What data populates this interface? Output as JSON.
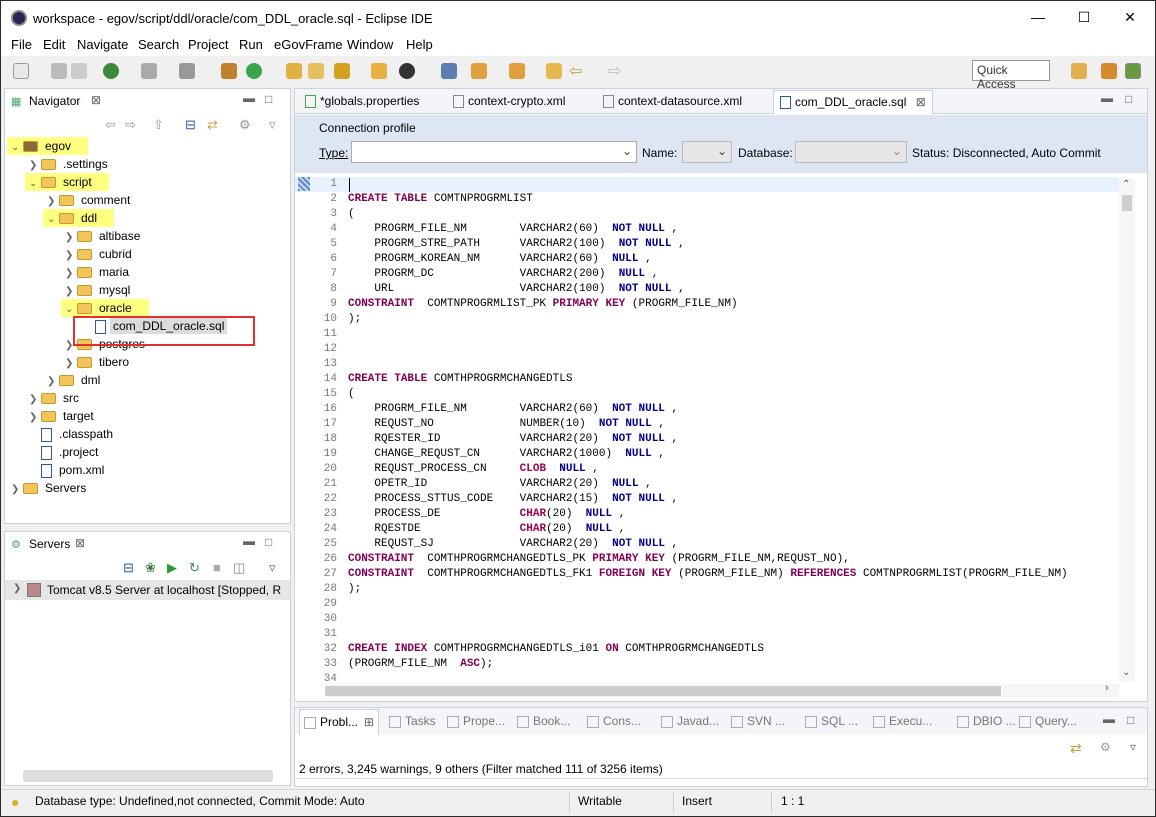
{
  "window": {
    "title": "workspace - egov/script/ddl/oracle/com_DDL_oracle.sql - Eclipse IDE"
  },
  "menu": [
    "File",
    "Edit",
    "Navigate",
    "Search",
    "Project",
    "Run",
    "eGovFrame",
    "Window",
    "Help"
  ],
  "toolbar": {
    "quick_access": "Quick Access"
  },
  "navigator": {
    "title": "Navigator",
    "tree": [
      {
        "label": "egov",
        "depth": 0,
        "type": "project",
        "expanded": true,
        "highlight": true
      },
      {
        "label": ".settings",
        "depth": 1,
        "type": "folder",
        "expanded": false
      },
      {
        "label": "script",
        "depth": 1,
        "type": "folder",
        "expanded": true,
        "highlight": true
      },
      {
        "label": "comment",
        "depth": 2,
        "type": "folder",
        "expanded": false
      },
      {
        "label": "ddl",
        "depth": 2,
        "type": "folder",
        "expanded": true,
        "highlight": true
      },
      {
        "label": "altibase",
        "depth": 3,
        "type": "folder",
        "expanded": false
      },
      {
        "label": "cubrid",
        "depth": 3,
        "type": "folder",
        "expanded": false
      },
      {
        "label": "maria",
        "depth": 3,
        "type": "folder",
        "expanded": false
      },
      {
        "label": "mysql",
        "depth": 3,
        "type": "folder",
        "expanded": false
      },
      {
        "label": "oracle",
        "depth": 3,
        "type": "folder",
        "expanded": true,
        "highlight": true
      },
      {
        "label": "com_DDL_oracle.sql",
        "depth": 4,
        "type": "file",
        "selected": true
      },
      {
        "label": "postgres",
        "depth": 3,
        "type": "folder",
        "expanded": false
      },
      {
        "label": "tibero",
        "depth": 3,
        "type": "folder",
        "expanded": false
      },
      {
        "label": "dml",
        "depth": 2,
        "type": "folder",
        "expanded": false
      },
      {
        "label": "src",
        "depth": 1,
        "type": "folder",
        "expanded": false
      },
      {
        "label": "target",
        "depth": 1,
        "type": "folder",
        "expanded": false
      },
      {
        "label": ".classpath",
        "depth": 1,
        "type": "xfile"
      },
      {
        "label": ".project",
        "depth": 1,
        "type": "xfile"
      },
      {
        "label": "pom.xml",
        "depth": 1,
        "type": "mfile"
      },
      {
        "label": "Servers",
        "depth": 0,
        "type": "folder",
        "expanded": false
      }
    ]
  },
  "servers": {
    "title": "Servers",
    "item": "Tomcat v8.5 Server at localhost  [Stopped, R"
  },
  "editor_tabs": [
    {
      "label": "*globals.properties",
      "active": false
    },
    {
      "label": "context-crypto.xml",
      "active": false
    },
    {
      "label": "context-datasource.xml",
      "active": false
    },
    {
      "label": "com_DDL_oracle.sql",
      "active": true
    }
  ],
  "connection": {
    "title": "Connection profile",
    "type_label": "Type:",
    "name_label": "Name:",
    "database_label": "Database:",
    "status": "Status: Disconnected, Auto Commit"
  },
  "code_lines": [
    "",
    "CREATE TABLE COMTNPROGRMLIST",
    "(",
    "    PROGRM_FILE_NM        VARCHAR2(60)  NOT NULL ,",
    "    PROGRM_STRE_PATH      VARCHAR2(100)  NOT NULL ,",
    "    PROGRM_KOREAN_NM      VARCHAR2(60)  NULL ,",
    "    PROGRM_DC             VARCHAR2(200)  NULL ,",
    "    URL                   VARCHAR2(100)  NOT NULL ,",
    "CONSTRAINT  COMTNPROGRMLIST_PK PRIMARY KEY (PROGRM_FILE_NM)",
    ");",
    "",
    "",
    "",
    "CREATE TABLE COMTHPROGRMCHANGEDTLS",
    "(",
    "    PROGRM_FILE_NM        VARCHAR2(60)  NOT NULL ,",
    "    REQUST_NO             NUMBER(10)  NOT NULL ,",
    "    RQESTER_ID            VARCHAR2(20)  NOT NULL ,",
    "    CHANGE_REQUST_CN      VARCHAR2(1000)  NULL ,",
    "    REQUST_PROCESS_CN     CLOB  NULL ,",
    "    OPETR_ID              VARCHAR2(20)  NULL ,",
    "    PROCESS_STTUS_CODE    VARCHAR2(15)  NOT NULL ,",
    "    PROCESS_DE            CHAR(20)  NULL ,",
    "    RQESTDE               CHAR(20)  NULL ,",
    "    REQUST_SJ             VARCHAR2(20)  NOT NULL ,",
    "CONSTRAINT  COMTHPROGRMCHANGEDTLS_PK PRIMARY KEY (PROGRM_FILE_NM,REQUST_NO),",
    "CONSTRAINT  COMTHPROGRMCHANGEDTLS_FK1 FOREIGN KEY (PROGRM_FILE_NM) REFERENCES COMTNPROGRMLIST(PROGRM_FILE_NM)",
    ");",
    "",
    "",
    "",
    "CREATE INDEX COMTHPROGRMCHANGEDTLS_i01 ON COMTHPROGRMCHANGEDTLS",
    "(PROGRM_FILE_NM  ASC);",
    ""
  ],
  "bottom_tabs": [
    "Probl...",
    "Tasks",
    "Prope...",
    "Book...",
    "Cons...",
    "Javad...",
    "SVN ...",
    "SQL ...",
    "Execu...",
    "DBIO ...",
    "Query..."
  ],
  "problems_summary": "2 errors, 3,245 warnings, 9 others (Filter matched 111 of 3256 items)",
  "statusbar": {
    "message": "Database type: Undefined,not connected, Commit Mode: Auto",
    "writable": "Writable",
    "insert": "Insert",
    "position": "1 : 1"
  }
}
